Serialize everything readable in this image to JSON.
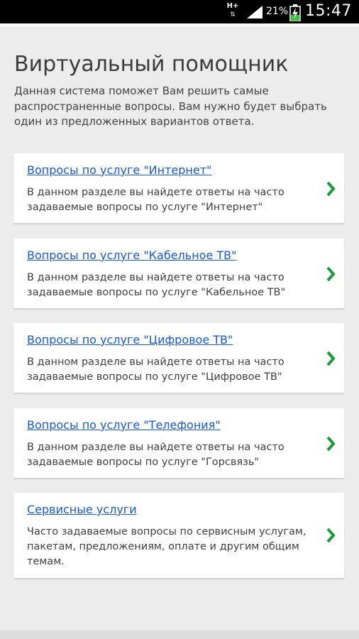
{
  "status_bar": {
    "network": "H+",
    "battery_percent": "21%",
    "time": "15:47",
    "icons": [
      "network-arrows-icon",
      "signal-icon",
      "battery-charging-icon"
    ]
  },
  "page": {
    "title": "Виртуальный помощник",
    "description": "Данная система поможет Вам решить самые распространенные вопросы. Вам нужно будет выбрать один из предложенных вариантов ответа."
  },
  "cards": [
    {
      "link": "Вопросы по услуге \"Интернет\"",
      "text": "В данном разделе вы найдете ответы на часто задаваемые вопросы по услуге \"Интернет\""
    },
    {
      "link": "Вопросы по услуге \"Кабельное ТВ\"",
      "text": "В данном разделе вы найдете ответы на часто задаваемые вопросы по услуге \"Кабельное ТВ\""
    },
    {
      "link": "Вопросы по услуге \"Цифровое ТВ\"",
      "text": "В данном разделе вы найдете ответы на часто задаваемые вопросы по услуге \"Цифровое ТВ\""
    },
    {
      "link": "Вопросы по услуге \"Телефония\"",
      "text": "В данном разделе вы найдете ответы на часто задаваемые вопросы по услуге \"Горсвязь\""
    },
    {
      "link": "Сервисные услуги",
      "text": "Часто задаваемые вопросы по сервисным услугам, пакетам, предложениям, оплате и другим общим темам."
    }
  ],
  "colors": {
    "link": "#1a5ac8",
    "chevron": "#1e9a3a",
    "background": "#ececec"
  }
}
